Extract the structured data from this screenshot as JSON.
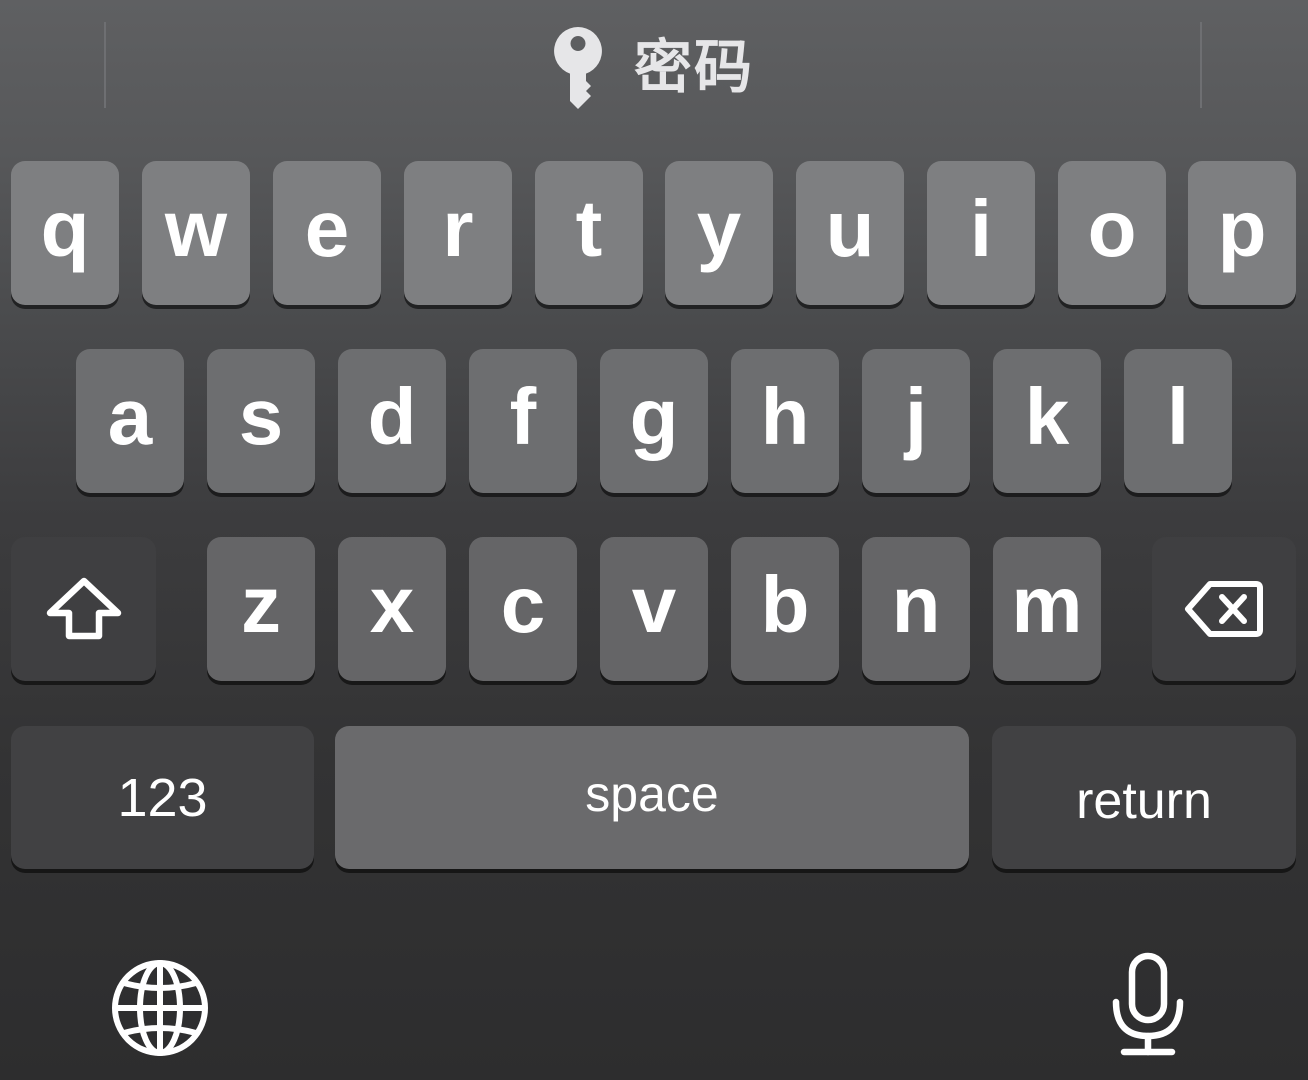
{
  "suggestion_bar": {
    "icon": "key-icon",
    "label": "密码"
  },
  "rows": {
    "row1": [
      "q",
      "w",
      "e",
      "r",
      "t",
      "y",
      "u",
      "i",
      "o",
      "p"
    ],
    "row2": [
      "a",
      "s",
      "d",
      "f",
      "g",
      "h",
      "j",
      "k",
      "l"
    ],
    "row3": [
      "z",
      "x",
      "c",
      "v",
      "b",
      "n",
      "m"
    ]
  },
  "function_keys": {
    "shift_icon": "shift-arrow-icon",
    "backspace_icon": "delete-icon",
    "numbers_label": "123",
    "space_label": "space",
    "return_label": "return"
  },
  "bottom_bar": {
    "left_icon": "globe-icon",
    "right_icon": "microphone-icon"
  },
  "colors": {
    "key_light": "#7e7f81",
    "key_dark": "#414143",
    "text": "#ffffff"
  }
}
